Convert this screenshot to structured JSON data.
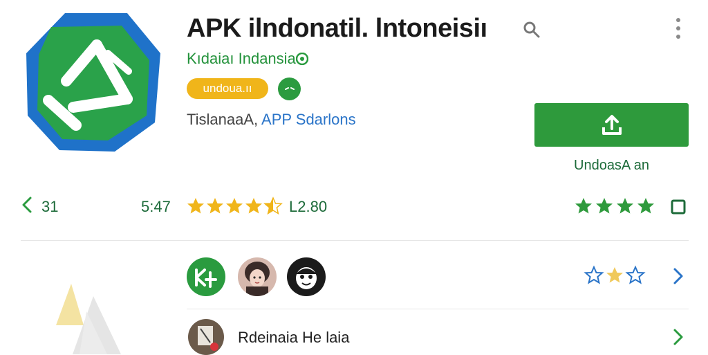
{
  "app": {
    "title": "APK ilndonatil. lntoneisiı",
    "developer": "Kıdaiaı Indansia",
    "install_pill": "undoua.ıı",
    "category_plain": "TislanaaA, ",
    "category_link": "APP Sdarlons"
  },
  "download": {
    "label": "UndoasA an"
  },
  "stats": {
    "back_count": "31",
    "time": "5:47",
    "rating_count": "L2.80",
    "rating_stars": 4.5,
    "right_stars": 4
  },
  "list": {
    "row2_label": "Rdeinaia He laia"
  },
  "icons": {
    "search": "search-icon",
    "more": "more-vert-icon",
    "download": "upload-arrow-icon",
    "bookmark": "bookmark-icon",
    "chevron": "chevron-right-icon",
    "back": "chevron-left-icon"
  },
  "colors": {
    "brand_green": "#2e9a3c",
    "brand_blue": "#1f72c9",
    "star_yellow": "#f0b51a",
    "link_blue": "#2a74c8",
    "text_green": "#1d6b3a"
  }
}
